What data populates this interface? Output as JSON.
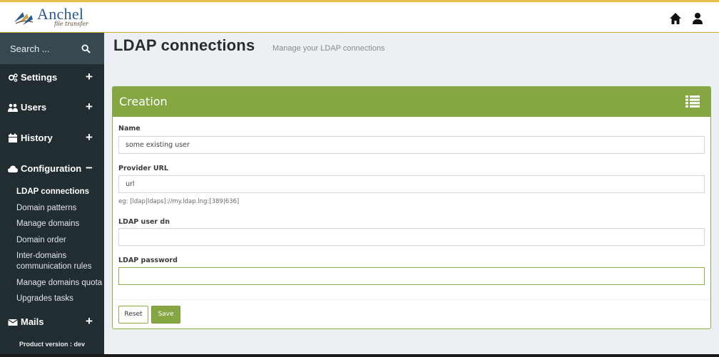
{
  "header": {
    "brand": "Anchel",
    "brand_sub": "file transfer"
  },
  "sidebar": {
    "search_placeholder": "Search ...",
    "items": [
      {
        "label": "Settings",
        "toggle": "+"
      },
      {
        "label": "Users",
        "toggle": "+"
      },
      {
        "label": "History",
        "toggle": "+"
      },
      {
        "label": "Configuration",
        "toggle": "−"
      },
      {
        "label": "Mails",
        "toggle": "+"
      }
    ],
    "sub_items": [
      "LDAP connections",
      "Domain patterns",
      "Manage domains",
      "Domain order",
      "Inter-domains",
      "communication rules",
      "Manage domains quota",
      "Upgrades tasks"
    ],
    "version": "Product version : dev"
  },
  "page": {
    "title": "LDAP connections",
    "subtitle": "Manage your LDAP connections"
  },
  "form": {
    "title": "Creation",
    "name_label": "Name",
    "name_value": "some existing user",
    "url_label": "Provider URL",
    "url_value": "url",
    "url_help": "eg: [ldap|ldaps]://my.ldap.lng:[389|636]",
    "dn_label": "LDAP user dn",
    "dn_value": "",
    "password_label": "LDAP password",
    "password_value": "",
    "reset_label": "Reset",
    "save_label": "Save"
  },
  "colors": {
    "accent": "#86a644",
    "sidebar_bg": "#222d32",
    "header_line": "#e5c04b"
  }
}
